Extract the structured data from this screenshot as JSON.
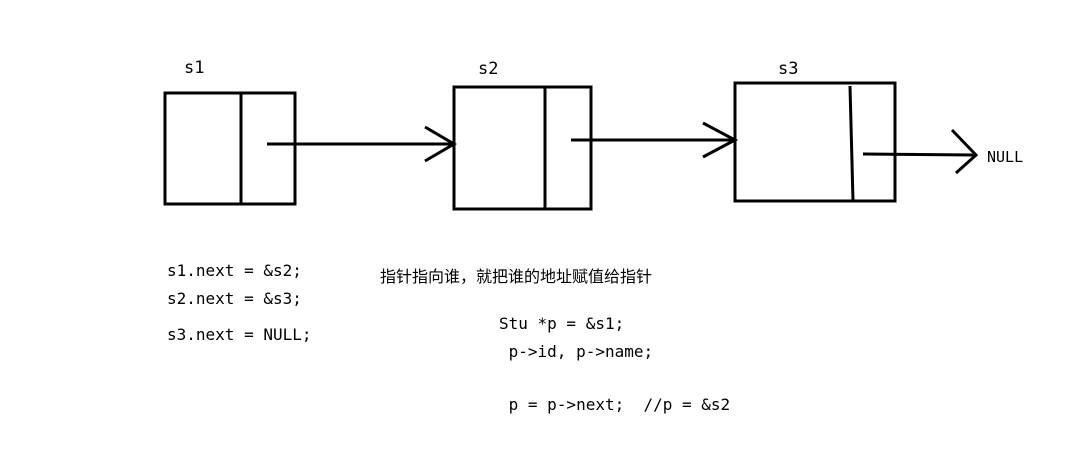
{
  "nodes": [
    {
      "label": "s1"
    },
    {
      "label": "s2"
    },
    {
      "label": "s3"
    }
  ],
  "null_label": "NULL",
  "assignments": [
    "s1.next = &s2;",
    "s2.next = &s3;",
    "s3.next = NULL;"
  ],
  "note": "指针指向谁，就把谁的地址赋值给指针",
  "code_lines": [
    "Stu *p = &s1;",
    " p->id, p->name;",
    " p = p->next;  //p = &s2"
  ]
}
